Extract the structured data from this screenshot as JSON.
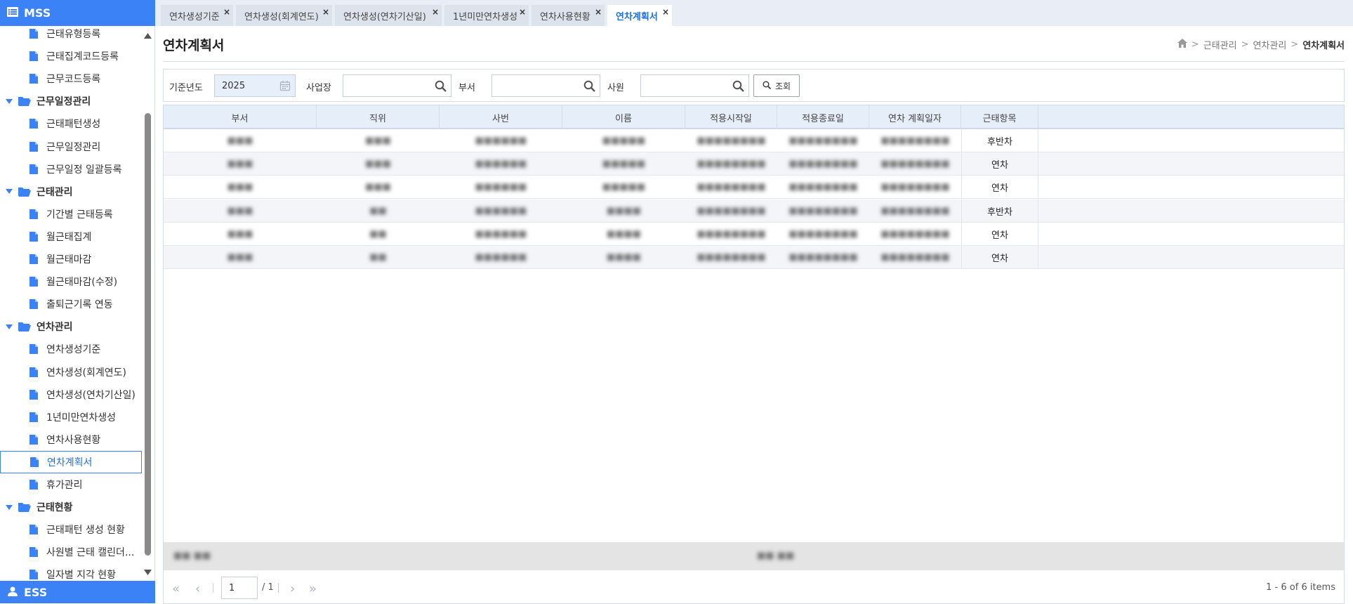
{
  "sidebar": {
    "title": "MSS",
    "bottom_title": "ESS",
    "items": [
      {
        "type": "leaf",
        "label": "근태유형등록"
      },
      {
        "type": "leaf",
        "label": "근태집계코드등록"
      },
      {
        "type": "leaf",
        "label": "근무코드등록"
      },
      {
        "type": "group",
        "label": "근무일정관리"
      },
      {
        "type": "leaf",
        "label": "근태패턴생성"
      },
      {
        "type": "leaf",
        "label": "근무일정관리"
      },
      {
        "type": "leaf",
        "label": "근무일정 일괄등록"
      },
      {
        "type": "group",
        "label": "근태관리"
      },
      {
        "type": "leaf",
        "label": "기간별 근태등록"
      },
      {
        "type": "leaf",
        "label": "월근태집계"
      },
      {
        "type": "leaf",
        "label": "월근태마감"
      },
      {
        "type": "leaf",
        "label": "월근태마감(수정)"
      },
      {
        "type": "leaf",
        "label": "출퇴근기록 연동"
      },
      {
        "type": "group",
        "label": "연차관리"
      },
      {
        "type": "leaf",
        "label": "연차생성기준"
      },
      {
        "type": "leaf",
        "label": "연차생성(회계연도)"
      },
      {
        "type": "leaf",
        "label": "연차생성(연차기산일)"
      },
      {
        "type": "leaf",
        "label": "1년미만연차생성"
      },
      {
        "type": "leaf",
        "label": "연차사용현황"
      },
      {
        "type": "leaf",
        "label": "연차계획서",
        "active": true
      },
      {
        "type": "leaf",
        "label": "휴가관리"
      },
      {
        "type": "group",
        "label": "근태현황"
      },
      {
        "type": "leaf",
        "label": "근태패턴 생성 현황"
      },
      {
        "type": "leaf",
        "label": "사원별 근태 캘린더..."
      },
      {
        "type": "leaf",
        "label": "일자별 지각 현황"
      }
    ]
  },
  "tabs": [
    {
      "label": "연차생성기준"
    },
    {
      "label": "연차생성(회계연도)"
    },
    {
      "label": "연차생성(연차기산일)"
    },
    {
      "label": "1년미만연차생성"
    },
    {
      "label": "연차사용현황"
    },
    {
      "label": "연차계획서",
      "active": true
    }
  ],
  "tab_close": "×",
  "page": {
    "title": "연차계획서",
    "breadcrumb": [
      "근태관리",
      "연차관리",
      "연차계획서"
    ],
    "breadcrumb_sep": ">"
  },
  "search": {
    "year_label": "기준년도",
    "year_value": "2025",
    "site_label": "사업장",
    "site_value": "",
    "dept_label": "부서",
    "dept_value": "",
    "emp_label": "사원",
    "emp_value": "",
    "button_label": "조회"
  },
  "grid": {
    "columns": [
      "부서",
      "직위",
      "사번",
      "이름",
      "적용시작일",
      "적용종료일",
      "연차 계획일자",
      "근태항목"
    ],
    "rows": [
      {
        "dept": "■■■",
        "pos": "■■■",
        "id": "■■■■■■",
        "name": "■■■■■",
        "start": "■■■■■■■■",
        "end": "■■■■■■■■",
        "plan": "■■■■■■■■",
        "type": "후반차"
      },
      {
        "dept": "■■■",
        "pos": "■■■",
        "id": "■■■■■■",
        "name": "■■■■■",
        "start": "■■■■■■■■",
        "end": "■■■■■■■■",
        "plan": "■■■■■■■■",
        "type": "연차"
      },
      {
        "dept": "■■■",
        "pos": "■■■",
        "id": "■■■■■■",
        "name": "■■■■■",
        "start": "■■■■■■■■",
        "end": "■■■■■■■■",
        "plan": "■■■■■■■■",
        "type": "연차"
      },
      {
        "dept": "■■■",
        "pos": "■■",
        "id": "■■■■■■",
        "name": "■■■■",
        "start": "■■■■■■■■",
        "end": "■■■■■■■■",
        "plan": "■■■■■■■■",
        "type": "후반차"
      },
      {
        "dept": "■■■",
        "pos": "■■",
        "id": "■■■■■■",
        "name": "■■■■",
        "start": "■■■■■■■■",
        "end": "■■■■■■■■",
        "plan": "■■■■■■■■",
        "type": "연차"
      },
      {
        "dept": "■■■",
        "pos": "■■",
        "id": "■■■■■■",
        "name": "■■■■",
        "start": "■■■■■■■■",
        "end": "■■■■■■■■",
        "plan": "■■■■■■■■",
        "type": "연차"
      }
    ],
    "footer_left": "■■ ■■",
    "footer_mid": "■■ ■■"
  },
  "pager": {
    "page_value": "1",
    "total": "/ 1",
    "items_info": "1 - 6 of 6 items",
    "first": "«",
    "prev": "‹",
    "next": "›",
    "last": "»"
  },
  "colors": {
    "accent": "#3b82f6",
    "header_bg": "#e6eef9",
    "active_tab_text": "#1e6fe0"
  }
}
